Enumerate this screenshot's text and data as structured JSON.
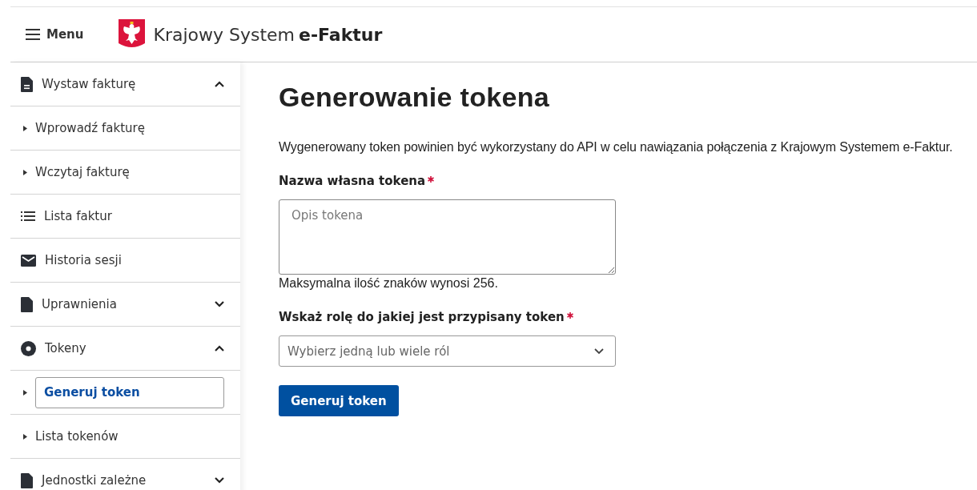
{
  "header": {
    "menu_label": "Menu",
    "brand": "Krajowy System",
    "brand_accent": "e-Faktur"
  },
  "sidebar": {
    "items": [
      {
        "label": "Wystaw fakturę",
        "kind": "document",
        "expanded": true,
        "selected": false,
        "children": [
          {
            "label": "Wprowadź fakturę",
            "selected": false
          },
          {
            "label": "Wczytaj fakturę",
            "selected": false
          }
        ]
      },
      {
        "label": "Lista faktur",
        "kind": "list",
        "selected": false
      },
      {
        "label": "Historia sesji",
        "kind": "mail",
        "selected": false
      },
      {
        "label": "Uprawnienia",
        "kind": "file",
        "expanded": false,
        "selected": false
      },
      {
        "label": "Tokeny",
        "kind": "disc",
        "expanded": true,
        "selected": false,
        "children": [
          {
            "label": "Generuj token",
            "selected": true
          },
          {
            "label": "Lista tokenów",
            "selected": false
          }
        ]
      },
      {
        "label": "Jednostki zależne",
        "kind": "file",
        "expanded": false,
        "selected": false
      }
    ]
  },
  "main": {
    "title": "Generowanie tokena",
    "description": "Wygenerowany token powinien być wykorzystany do API w celu nawiązania połączenia z Krajowym Systemem e-Faktur.",
    "fields": [
      {
        "kind": "textarea",
        "label": "Nazwa własna tokena",
        "required": true,
        "placeholder": "Opis tokena",
        "hint": "Maksymalna ilość znaków wynosi 256."
      },
      {
        "kind": "select",
        "label": "Wskaż rolę do jakiej jest przypisany token",
        "required": true,
        "placeholder": "Wybierz jedną lub wiele ról"
      }
    ],
    "submit": "Generuj token"
  }
}
